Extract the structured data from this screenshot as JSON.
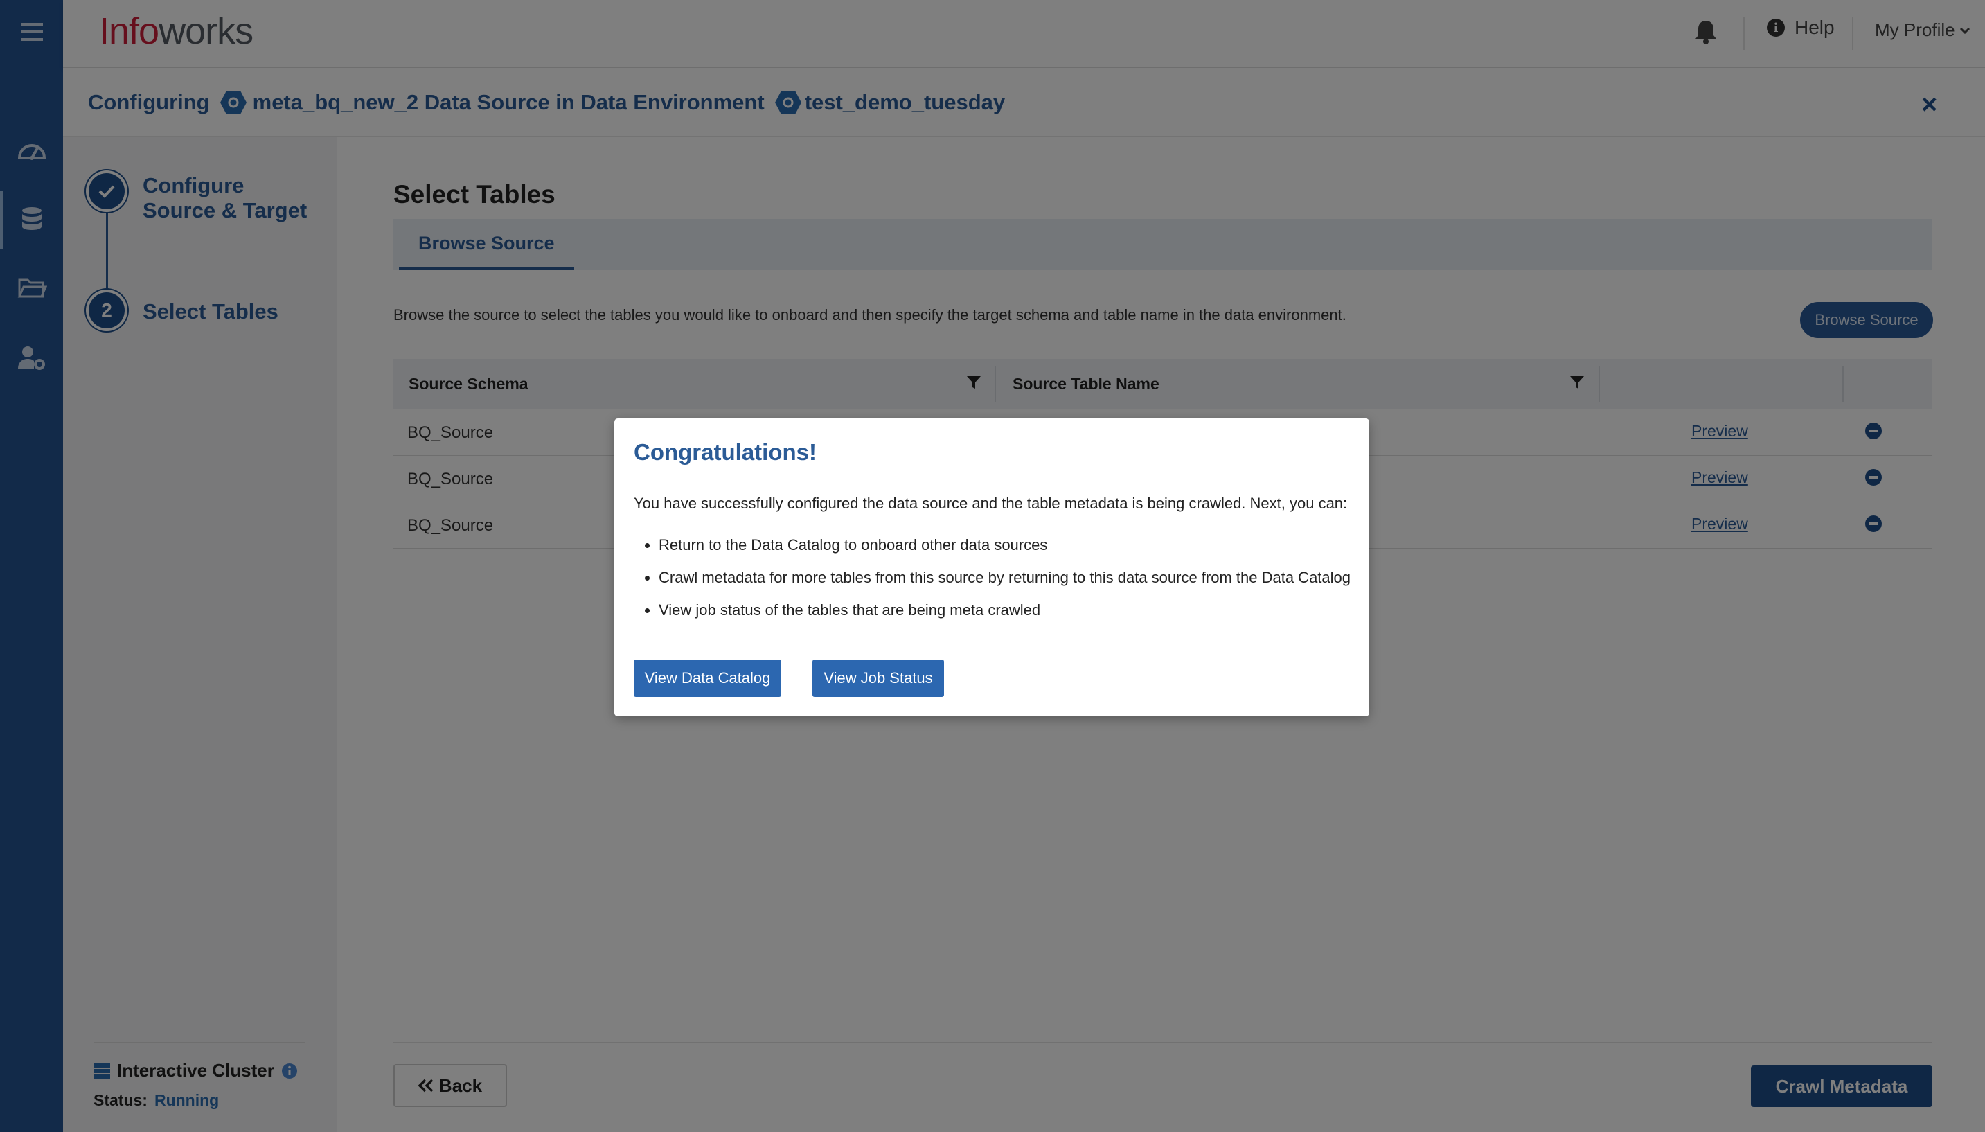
{
  "header": {
    "logo_part1": "Info",
    "logo_part2": "works",
    "help_label": "Help",
    "profile_label": "My Profile"
  },
  "breadcrumb": {
    "prefix": "Configuring",
    "source": "meta_bq_new_2 Data Source in Data Environment",
    "environment": "test_demo_tuesday"
  },
  "steps": [
    {
      "label_line1": "Configure",
      "label_line2": "Source & Target",
      "state": "completed"
    },
    {
      "number": "2",
      "label": "Select Tables",
      "state": "current"
    }
  ],
  "cluster": {
    "title": "Interactive Cluster",
    "status_label": "Status:",
    "status_value": "Running"
  },
  "main": {
    "section_title": "Select Tables",
    "tab_label": "Browse Source",
    "description": "Browse the source to select the tables you would like to onboard and then specify the target schema and table name in the data environment.",
    "browse_button": "Browse Source",
    "columns": [
      "Source Schema",
      "Source Table Name"
    ],
    "rows": [
      {
        "schema": "BQ_Source",
        "preview": "Preview"
      },
      {
        "schema": "BQ_Source",
        "preview": "Preview"
      },
      {
        "schema": "BQ_Source",
        "preview": "Preview"
      }
    ],
    "back_button": "Back",
    "crawl_button": "Crawl Metadata"
  },
  "modal": {
    "title": "Congratulations!",
    "message": "You have successfully configured the data source and the table metadata is being crawled. Next, you can:",
    "bullets": [
      "Return to the Data Catalog to onboard other data sources",
      "Crawl metadata for more tables from this source by returning to this data source from the Data Catalog",
      "View job status of the tables that are being meta crawled"
    ],
    "button_catalog": "View Data Catalog",
    "button_jobs": "View Job Status"
  },
  "colors": {
    "rail": "#245493",
    "accent": "#2b5b96",
    "primary_button": "#1f4f8a",
    "logo_red": "#cc1f3a",
    "logo_gray": "#555b63"
  },
  "icons": {
    "rail": [
      "menu-icon",
      "dashboard-icon",
      "database-icon",
      "folder-icon",
      "user-settings-icon"
    ],
    "header": [
      "bell-icon",
      "info-icon",
      "chevron-down-icon"
    ]
  }
}
